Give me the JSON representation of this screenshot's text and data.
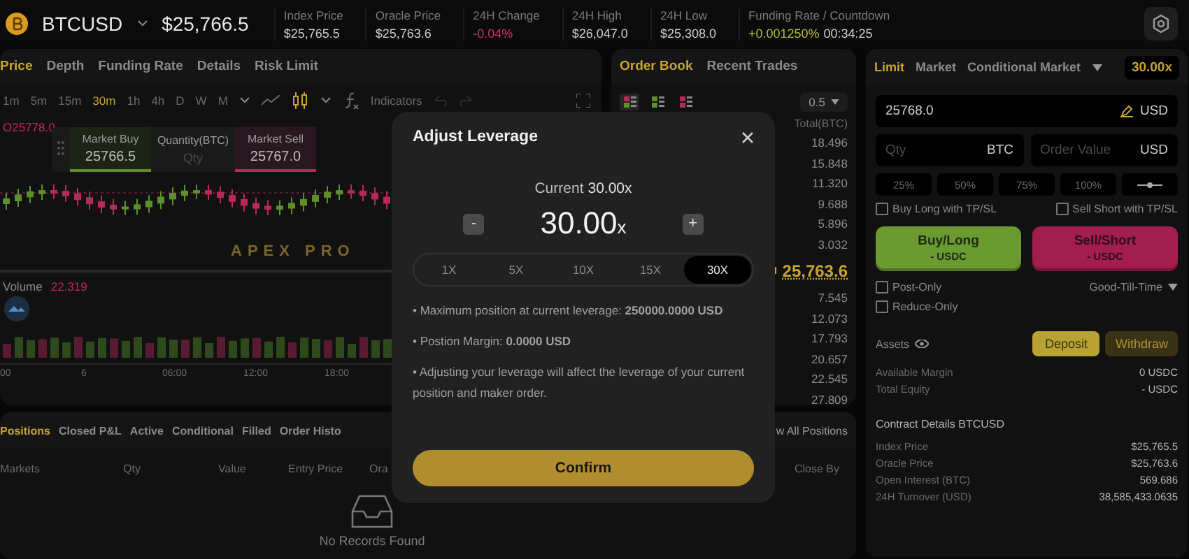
{
  "header": {
    "symbol": "BTCUSD",
    "price": "$25,766.5",
    "stats": [
      {
        "label": "Index Price",
        "value": "$25,765.5",
        "kind": "plain"
      },
      {
        "label": "Oracle Price",
        "value": "$25,763.6",
        "kind": "plain"
      },
      {
        "label": "24H Change",
        "value": "-0.04%",
        "kind": "down"
      },
      {
        "label": "24H High",
        "value": "$26,047.0",
        "kind": "plain"
      },
      {
        "label": "24H Low",
        "value": "$25,308.0",
        "kind": "plain"
      },
      {
        "label": "Funding Rate / Countdown",
        "value": "+0.001250%",
        "extra": "00:34:25",
        "kind": "up"
      }
    ]
  },
  "chart_panel": {
    "tabs": [
      {
        "label": "Price",
        "selected": true
      },
      {
        "label": "Depth",
        "selected": false
      },
      {
        "label": "Funding Rate",
        "selected": false
      },
      {
        "label": "Details",
        "selected": false
      },
      {
        "label": "Risk Limit",
        "selected": false
      }
    ],
    "intervals": [
      {
        "label": "1m",
        "selected": false
      },
      {
        "label": "5m",
        "selected": false
      },
      {
        "label": "15m",
        "selected": false
      },
      {
        "label": "30m",
        "selected": true
      },
      {
        "label": "1h",
        "selected": false
      },
      {
        "label": "4h",
        "selected": false
      },
      {
        "label": "D",
        "selected": false
      },
      {
        "label": "W",
        "selected": false
      },
      {
        "label": "M",
        "selected": false
      }
    ],
    "indicators": "Indicators",
    "ohlc_open": "O25778.0",
    "watermark_logo": "APEX PRO",
    "quick_trade": {
      "buy_label": "Market Buy",
      "buy_price": "25766.5",
      "qty_label": "Quantity(BTC)",
      "qty_placeholder": "Qty",
      "sell_label": "Market Sell",
      "sell_price": "25767.0"
    },
    "volume_label": "Volume",
    "volume_value": "22.319",
    "time_labels": [
      "00",
      "6",
      "06:00",
      "12:00",
      "18:00"
    ]
  },
  "order_book": {
    "tabs": [
      {
        "label": "Order Book",
        "selected": true
      },
      {
        "label": "Recent Trades",
        "selected": false
      }
    ],
    "layout_modes": [
      {
        "kind": "both",
        "selected": true
      },
      {
        "kind": "bids",
        "selected": false
      },
      {
        "kind": "asks",
        "selected": false
      }
    ],
    "precision": "0.5",
    "total_header": "Total(BTC)",
    "asks": [
      "18.496",
      "15.848",
      "11.320",
      "9.688",
      "5.896",
      "3.032"
    ],
    "last_price": "25,763.6",
    "bids": [
      "7.545",
      "12.073",
      "17.793",
      "20.657",
      "22.545",
      "27.809"
    ]
  },
  "positions": {
    "tabs": [
      {
        "label": "Positions",
        "selected": true
      },
      {
        "label": "Closed P&L",
        "selected": false
      },
      {
        "label": "Active",
        "selected": false
      },
      {
        "label": "Conditional",
        "selected": false
      },
      {
        "label": "Filled",
        "selected": false
      },
      {
        "label": "Order Histo",
        "selected": false
      }
    ],
    "view_all": "w All Positions",
    "columns": [
      "Markets",
      "Qty",
      "Value",
      "Entry Price",
      "Ora",
      "Close By"
    ],
    "empty_text": "No Records Found"
  },
  "order_form": {
    "tabs": [
      {
        "label": "Limit",
        "selected": true
      },
      {
        "label": "Market",
        "selected": false
      },
      {
        "label": "Conditional Market",
        "selected": false
      }
    ],
    "leverage": "30.00x",
    "price_field": {
      "value": "25768.0",
      "unit": "USD"
    },
    "qty_field": {
      "placeholder": "Qty",
      "unit": "BTC"
    },
    "value_field": {
      "placeholder": "Order Value",
      "unit": "USD"
    },
    "percents": [
      "25%",
      "50%",
      "75%",
      "100%"
    ],
    "tpsl": [
      {
        "label": "Buy Long with TP/SL",
        "checked": false
      },
      {
        "label": "Sell Short with TP/SL",
        "checked": false
      }
    ],
    "buy": {
      "label": "Buy/Long",
      "sub": "- USDC"
    },
    "sell": {
      "label": "Sell/Short",
      "sub": "- USDC"
    },
    "options": [
      {
        "label": "Post-Only",
        "checked": false
      },
      {
        "label": "Reduce-Only",
        "checked": false
      }
    ],
    "time_in_force": "Good-Till-Time",
    "assets": {
      "label": "Assets",
      "deposit": "Deposit",
      "withdraw": "Withdraw",
      "rows": [
        {
          "label": "Available Margin",
          "value": "0 USDC"
        },
        {
          "label": "Total Equity",
          "value": "- USDC"
        }
      ]
    },
    "contract": {
      "title": "Contract Details BTCUSD",
      "rows": [
        {
          "label": "Index Price",
          "value": "$25,765.5"
        },
        {
          "label": "Oracle Price",
          "value": "$25,763.6"
        },
        {
          "label": "Open Interest (BTC)",
          "value": "569.686"
        },
        {
          "label": "24H Turnover (USD)",
          "value": "38,585,433.0635"
        }
      ]
    }
  },
  "modal": {
    "title": "Adjust Leverage",
    "current_label": "Current",
    "current_value": "30.00x",
    "value": "30.00",
    "unit": "x",
    "minus": "-",
    "plus": "+",
    "options": [
      {
        "label": "1X",
        "selected": false
      },
      {
        "label": "5X",
        "selected": false
      },
      {
        "label": "10X",
        "selected": false
      },
      {
        "label": "15X",
        "selected": false
      },
      {
        "label": "30X",
        "selected": true
      }
    ],
    "notes": [
      "• Maximum position at current leverage: **250000.0000 USD**",
      "• Postion Margin: **0.0000 USD**",
      "• Adjusting your leverage will affect the leverage of your current position and maker order."
    ],
    "confirm": "Confirm"
  }
}
